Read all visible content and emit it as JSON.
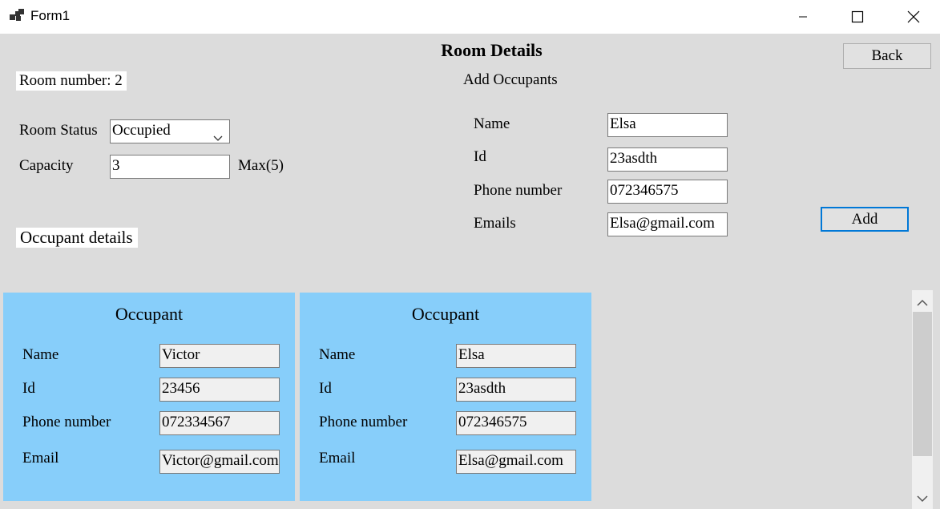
{
  "window": {
    "title": "Form1",
    "icon": "app-window-icon",
    "controls": [
      "minimize-icon",
      "maximize-icon",
      "close-icon"
    ]
  },
  "header": {
    "title": "Room Details",
    "back_label": "Back"
  },
  "room": {
    "number_label": "Room number: 2",
    "status_label": "Room Status",
    "status_value": "Occupied",
    "capacity_label": "Capacity",
    "capacity_value": "3",
    "max_label": "Max(5)"
  },
  "add_occupants": {
    "heading": "Add Occupants",
    "name_label": "Name",
    "name_value": "Elsa",
    "id_label": "Id",
    "id_value": "23asdth",
    "phone_label": "Phone number",
    "phone_value": "072346575",
    "emails_label": "Emails",
    "emails_value": "Elsa@gmail.com",
    "add_label": "Add"
  },
  "occupant_details": {
    "heading": "Occupant details",
    "cards": [
      {
        "title": "Occupant",
        "name_label": "Name",
        "name": "Victor",
        "id_label": "Id",
        "id": "23456",
        "phone_label": "Phone number",
        "phone": "072334567",
        "email_label": "Email",
        "email": "Victor@gmail.com"
      },
      {
        "title": "Occupant",
        "name_label": "Name",
        "name": "Elsa",
        "id_label": "Id",
        "id": "23asdth",
        "phone_label": "Phone number",
        "phone": "072346575",
        "email_label": "Email",
        "email": "Elsa@gmail.com"
      }
    ]
  },
  "colors": {
    "card_bg": "#87cefa",
    "form_bg": "#dcdcdc",
    "focus_border": "#0078d7"
  }
}
